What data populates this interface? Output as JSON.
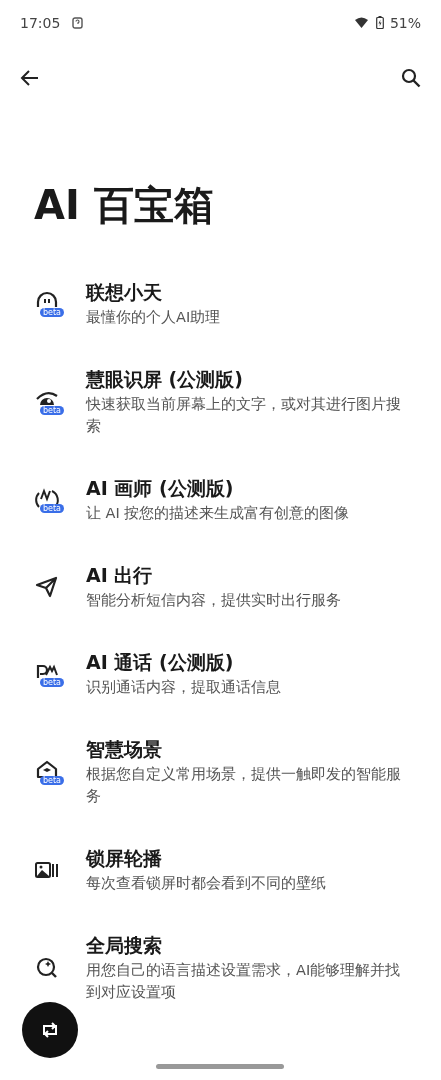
{
  "status_bar": {
    "time": "17:05",
    "battery": "51%"
  },
  "page": {
    "title": "AI 百宝箱"
  },
  "items": [
    {
      "kind": "assistant",
      "title": "联想小天",
      "subtitle": "最懂你的个人AI助理",
      "badge": "beta"
    },
    {
      "kind": "eye",
      "title": "慧眼识屏 (公测版)",
      "subtitle": "快速获取当前屏幕上的文字，或对其进行图片搜索",
      "badge": "beta"
    },
    {
      "kind": "painter",
      "title": "AI 画师 (公测版)",
      "subtitle": "让 AI 按您的描述来生成富有创意的图像",
      "badge": "beta"
    },
    {
      "kind": "travel",
      "title": "AI 出行",
      "subtitle": "智能分析短信内容，提供实时出行服务"
    },
    {
      "kind": "call",
      "title": "AI 通话 (公测版)",
      "subtitle": "识别通话内容，提取通话信息",
      "badge": "beta"
    },
    {
      "kind": "scene",
      "title": "智慧场景",
      "subtitle": "根据您自定义常用场景，提供一触即发的智能服务",
      "badge": "beta"
    },
    {
      "kind": "wallpaper",
      "title": "锁屏轮播",
      "subtitle": "每次查看锁屏时都会看到不同的壁纸"
    },
    {
      "kind": "search",
      "title": "全局搜索",
      "subtitle": "用您自己的语言描述设置需求，AI能够理解并找到对应设置项"
    }
  ]
}
